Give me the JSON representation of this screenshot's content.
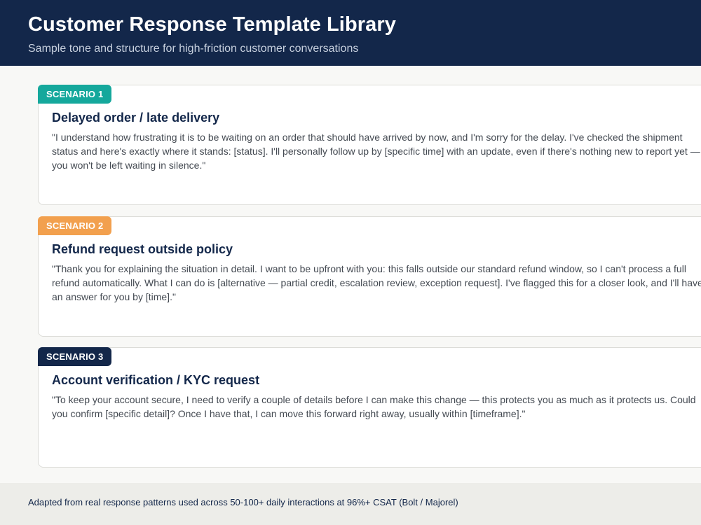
{
  "header": {
    "title": "Customer Response Template Library",
    "subtitle": "Sample tone and structure for high-friction customer conversations"
  },
  "colors": {
    "header_bg": "#13274a",
    "scenario1_badge": "#15a89c",
    "scenario2_badge": "#f2a04e",
    "scenario3_badge": "#13274a"
  },
  "scenarios": [
    {
      "badge": "SCENARIO 1",
      "title": "Delayed order / late delivery",
      "quote": "\"I understand how frustrating it is to be waiting on an order that should have arrived by now, and I'm sorry for the delay. I've checked the shipment status and here's exactly where it stands: [status]. I'll personally follow up by [specific time] with an update, even if there's nothing new to report yet — you won't be left waiting in silence.\""
    },
    {
      "badge": "SCENARIO 2",
      "title": "Refund request outside policy",
      "quote": "\"Thank you for explaining the situation in detail. I want to be upfront with you: this falls outside our standard refund window, so I can't process a full refund automatically. What I can do is [alternative — partial credit, escalation review, exception request]. I've flagged this for a closer look, and I'll have an answer for you by [time].\""
    },
    {
      "badge": "SCENARIO 3",
      "title": "Account verification / KYC request",
      "quote": "\"To keep your account secure, I need to verify a couple of details before I can make this change — this protects you as much as it protects us. Could you confirm [specific detail]? Once I have that, I can move this forward right away, usually within [timeframe].\""
    }
  ],
  "footer": {
    "note": "Adapted from real response patterns used across 50-100+ daily interactions at 96%+ CSAT (Bolt / Majorel)"
  }
}
